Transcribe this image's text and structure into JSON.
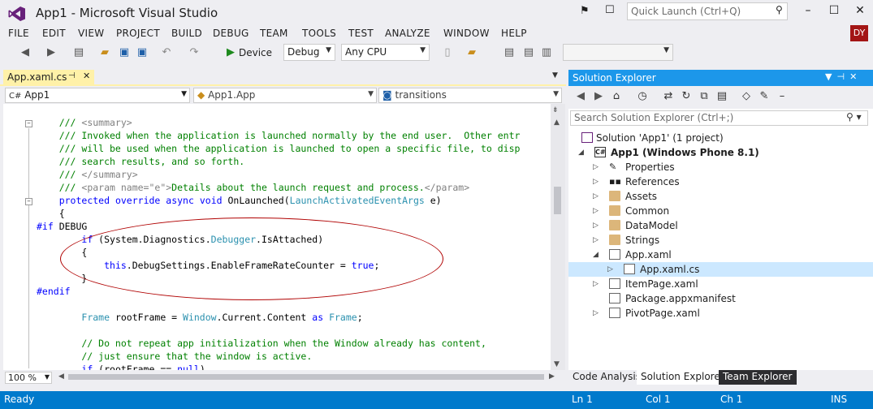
{
  "window": {
    "title": "App1 - Microsoft Visual Studio",
    "quick_launch_placeholder": "Quick Launch (Ctrl+Q)",
    "user_initials": "DY"
  },
  "menu": [
    "FILE",
    "EDIT",
    "VIEW",
    "PROJECT",
    "BUILD",
    "DEBUG",
    "TEAM",
    "TOOLS",
    "TEST",
    "ANALYZE",
    "WINDOW",
    "HELP"
  ],
  "toolbar": {
    "run_label": "Device",
    "configuration": "Debug",
    "platform": "Any CPU"
  },
  "editor": {
    "tab_label": "App.xaml.cs",
    "nav_project": "App1",
    "nav_class": "App1.App",
    "nav_member": "transitions",
    "zoom": "100 %",
    "code_lines": [
      "    /// <summary>",
      "    /// Invoked when the application is launched normally by the end user.  Other entr",
      "    /// will be used when the application is launched to open a specific file, to disp",
      "    /// search results, and so forth.",
      "    /// </summary>",
      "    /// <param name=\"e\">Details about the launch request and process.</param>",
      "    protected override async void OnLaunched(LaunchActivatedEventArgs e)",
      "    {",
      "#if DEBUG",
      "        if (System.Diagnostics.Debugger.IsAttached)",
      "        {",
      "            this.DebugSettings.EnableFrameRateCounter = true;",
      "        }",
      "#endif",
      "",
      "        Frame rootFrame = Window.Current.Content as Frame;",
      "",
      "        // Do not repeat app initialization when the Window already has content,",
      "        // just ensure that the window is active.",
      "        if (rootFrame == null)"
    ]
  },
  "solution_explorer": {
    "title": "Solution Explorer",
    "search_placeholder": "Search Solution Explorer (Ctrl+;)",
    "items": [
      {
        "label": "Solution 'App1' (1 project)",
        "icon": "solution-icon",
        "expander": ""
      },
      {
        "label": "App1 (Windows Phone 8.1)",
        "icon": "csharp-project-icon",
        "expander": "expanded"
      },
      {
        "label": "Properties",
        "icon": "wrench-icon",
        "expander": "collapsed"
      },
      {
        "label": "References",
        "icon": "references-icon",
        "expander": "collapsed"
      },
      {
        "label": "Assets",
        "icon": "folder-icon",
        "expander": "collapsed"
      },
      {
        "label": "Common",
        "icon": "folder-icon",
        "expander": "collapsed"
      },
      {
        "label": "DataModel",
        "icon": "folder-icon",
        "expander": "collapsed"
      },
      {
        "label": "Strings",
        "icon": "folder-icon",
        "expander": "collapsed"
      },
      {
        "label": "App.xaml",
        "icon": "xaml-file-icon",
        "expander": "expanded"
      },
      {
        "label": "App.xaml.cs",
        "icon": "cs-file-icon",
        "expander": "collapsed"
      },
      {
        "label": "ItemPage.xaml",
        "icon": "xaml-file-icon",
        "expander": "collapsed"
      },
      {
        "label": "Package.appxmanifest",
        "icon": "manifest-file-icon",
        "expander": ""
      },
      {
        "label": "PivotPage.xaml",
        "icon": "xaml-file-icon",
        "expander": "collapsed"
      }
    ],
    "tabs": [
      "Code Analysis",
      "Solution Explorer",
      "Team Explorer"
    ]
  },
  "status": {
    "state": "Ready",
    "line": "Ln 1",
    "col": "Col 1",
    "ch": "Ch 1",
    "mode": "INS"
  },
  "colors": {
    "accent": "#007acc",
    "panel_title": "#1c97ea",
    "active_tab": "#fff1a8",
    "annotation": "#b00000"
  }
}
